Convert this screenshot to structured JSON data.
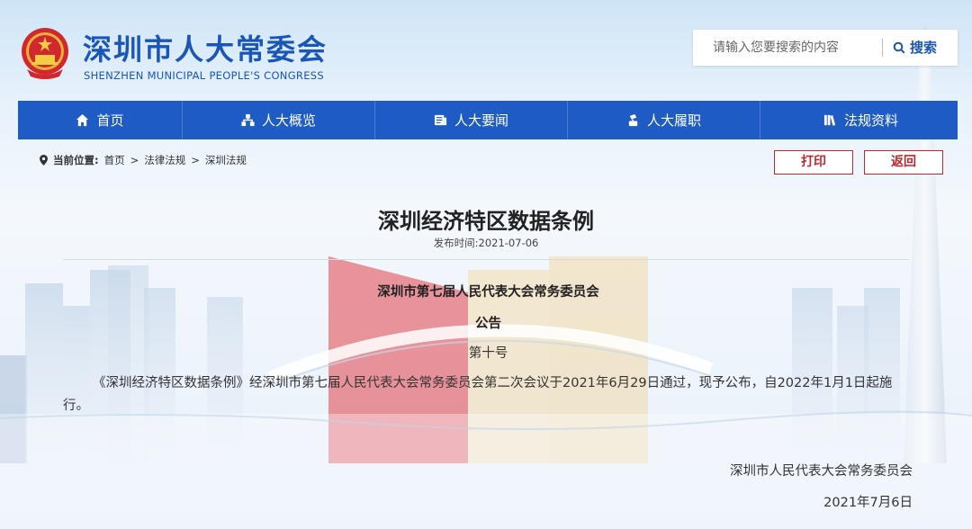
{
  "header": {
    "title": "深圳市人大常委会",
    "subtitle": "SHENZHEN MUNICIPAL PEOPLE'S CONGRESS"
  },
  "search": {
    "placeholder": "请输入您要搜索的内容",
    "button_label": "搜索"
  },
  "nav": {
    "items": [
      {
        "label": "首页",
        "icon": "home-icon"
      },
      {
        "label": "人大概览",
        "icon": "org-chart-icon"
      },
      {
        "label": "人大要闻",
        "icon": "news-icon"
      },
      {
        "label": "人大履职",
        "icon": "duty-icon"
      },
      {
        "label": "法规资料",
        "icon": "books-icon"
      }
    ]
  },
  "breadcrumb": {
    "label": "当前位置:",
    "items": [
      "首页",
      "法律法规",
      "深圳法规"
    ],
    "separator": ">"
  },
  "actions": {
    "print_label": "打印",
    "back_label": "返回"
  },
  "article": {
    "title": "深圳经济特区数据条例",
    "publish_date": "发布时间:2021-07-06",
    "issuer": "深圳市第七届人民代表大会常务委员会",
    "doc_type": "公告",
    "doc_number": "第十号",
    "body": "《深圳经济特区数据条例》经深圳市第七届人民代表大会常务委员会第二次会议于2021年6月29日通过，现予公布，自2022年1月1日起施行。",
    "signature": "深圳市人民代表大会常务委员会",
    "signature_date": "2021年7月6日"
  },
  "colors": {
    "brand_blue": "#1f5bc5",
    "action_red": "#c0262d"
  }
}
